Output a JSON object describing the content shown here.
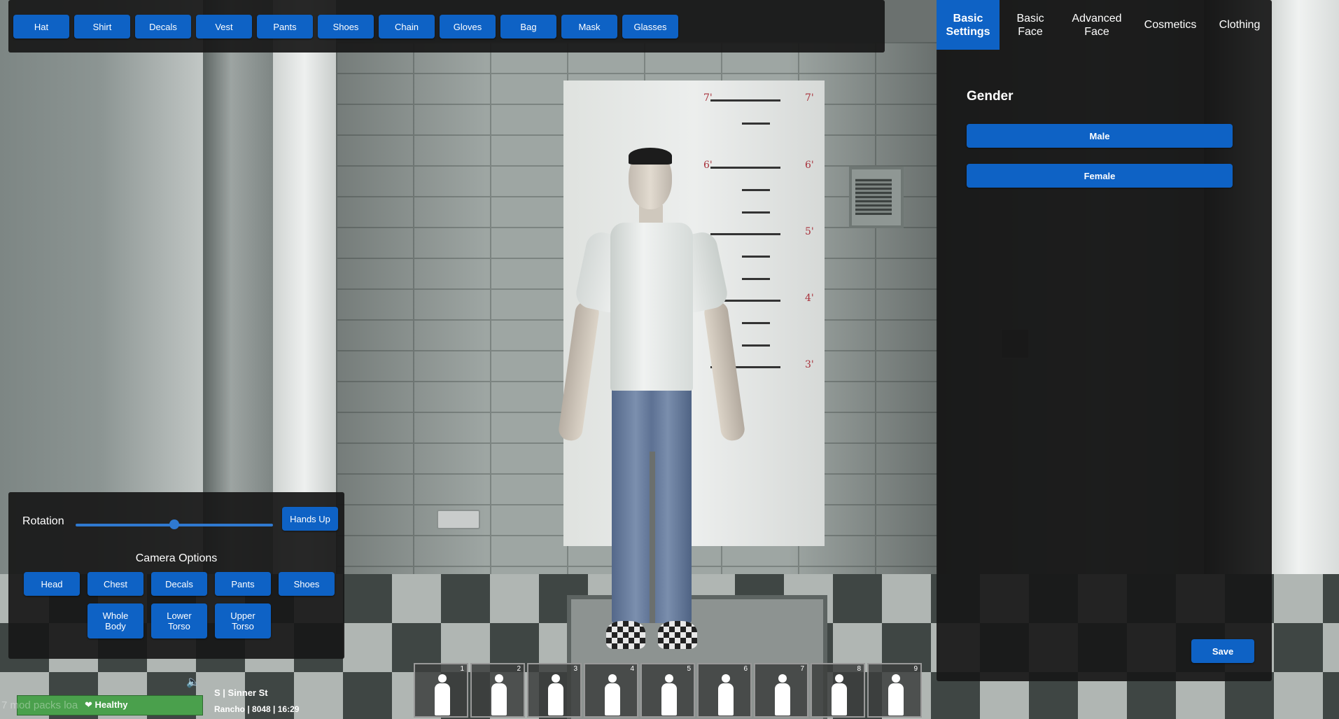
{
  "clothing_bar": {
    "items": [
      "Hat",
      "Shirt",
      "Decals",
      "Vest",
      "Pants",
      "Shoes",
      "Chain",
      "Gloves",
      "Bag",
      "Mask",
      "Glasses"
    ]
  },
  "tabs": [
    {
      "label": "Basic Settings",
      "active": true
    },
    {
      "label": "Basic Face",
      "active": false
    },
    {
      "label": "Advanced Face",
      "active": false
    },
    {
      "label": "Cosmetics",
      "active": false
    },
    {
      "label": "Clothing",
      "active": false
    }
  ],
  "basic_settings": {
    "gender_title": "Gender",
    "male_label": "Male",
    "female_label": "Female",
    "save_label": "Save"
  },
  "controls": {
    "rotation_label": "Rotation",
    "rotation_value": 0.5,
    "hands_up_label": "Hands Up",
    "camera_title": "Camera Options",
    "camera_buttons_row1": [
      "Head",
      "Chest",
      "Decals",
      "Pants",
      "Shoes"
    ],
    "camera_buttons_row2": [
      "Whole Body",
      "Lower Torso",
      "Upper Torso"
    ]
  },
  "hotbar": {
    "slots": [
      "1",
      "2",
      "3",
      "4",
      "5",
      "6",
      "7",
      "8",
      "9"
    ]
  },
  "hud": {
    "health_status": "Healthy",
    "mod_packs_text": "7 mod packs loa",
    "location_line1": "S | Sinner St",
    "location_line2": "Rancho | 8048 | 16:29"
  },
  "height_chart": {
    "marks": [
      "7'",
      "6'",
      "5'",
      "4'",
      "3'"
    ]
  },
  "colors": {
    "accent": "#0e62c5",
    "panel": "#181818",
    "health": "#4aa04c"
  }
}
